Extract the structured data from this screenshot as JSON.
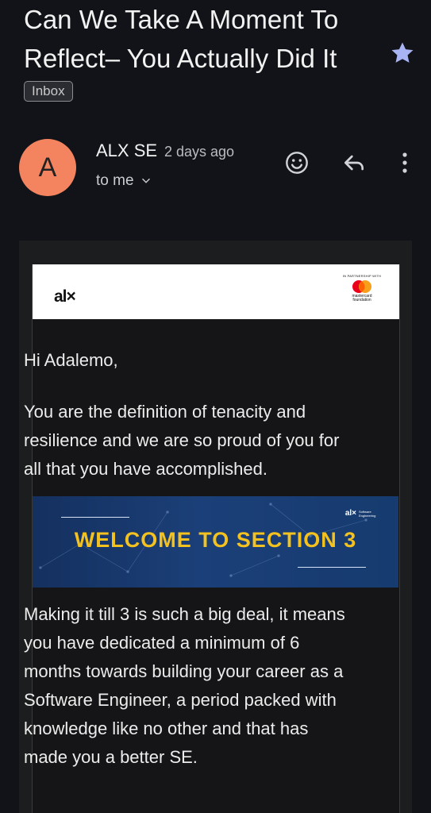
{
  "subject": "Can We Take A Moment To Reflect– You Actually Did It",
  "label": "Inbox",
  "colors": {
    "avatar": "#f4845f",
    "star": "#a9b4f5",
    "hero_text": "#f4c21f",
    "background": "#111318"
  },
  "sender": {
    "avatar_letter": "A",
    "name": "ALX SE",
    "time": "2 days ago",
    "recipient": "to me"
  },
  "icons": {
    "star": "star-icon",
    "emoji": "emoji-react-icon",
    "reply": "reply-icon",
    "more": "more-vert-icon",
    "expand": "chevron-down-icon"
  },
  "email": {
    "logo": "al×",
    "partner_tagline": "IN PARTNERSHIP WITH",
    "partner_name_line1": "mastercard",
    "partner_name_line2": "foundation",
    "greeting": "Hi Adalemo,",
    "paragraph1": "You are the definition of tenacity and resilience and we are so proud of you for all that you have accomplished.",
    "hero": {
      "title": "WELCOME TO SECTION 3",
      "brand": "al×",
      "brand_sub": "Software Engineering"
    },
    "paragraph2": "Making it till 3 is such a big deal, it means you have dedicated a minimum of 6 months towards building your career as a Software Engineer, a period packed with knowledge like no other and that has made you a better SE."
  }
}
